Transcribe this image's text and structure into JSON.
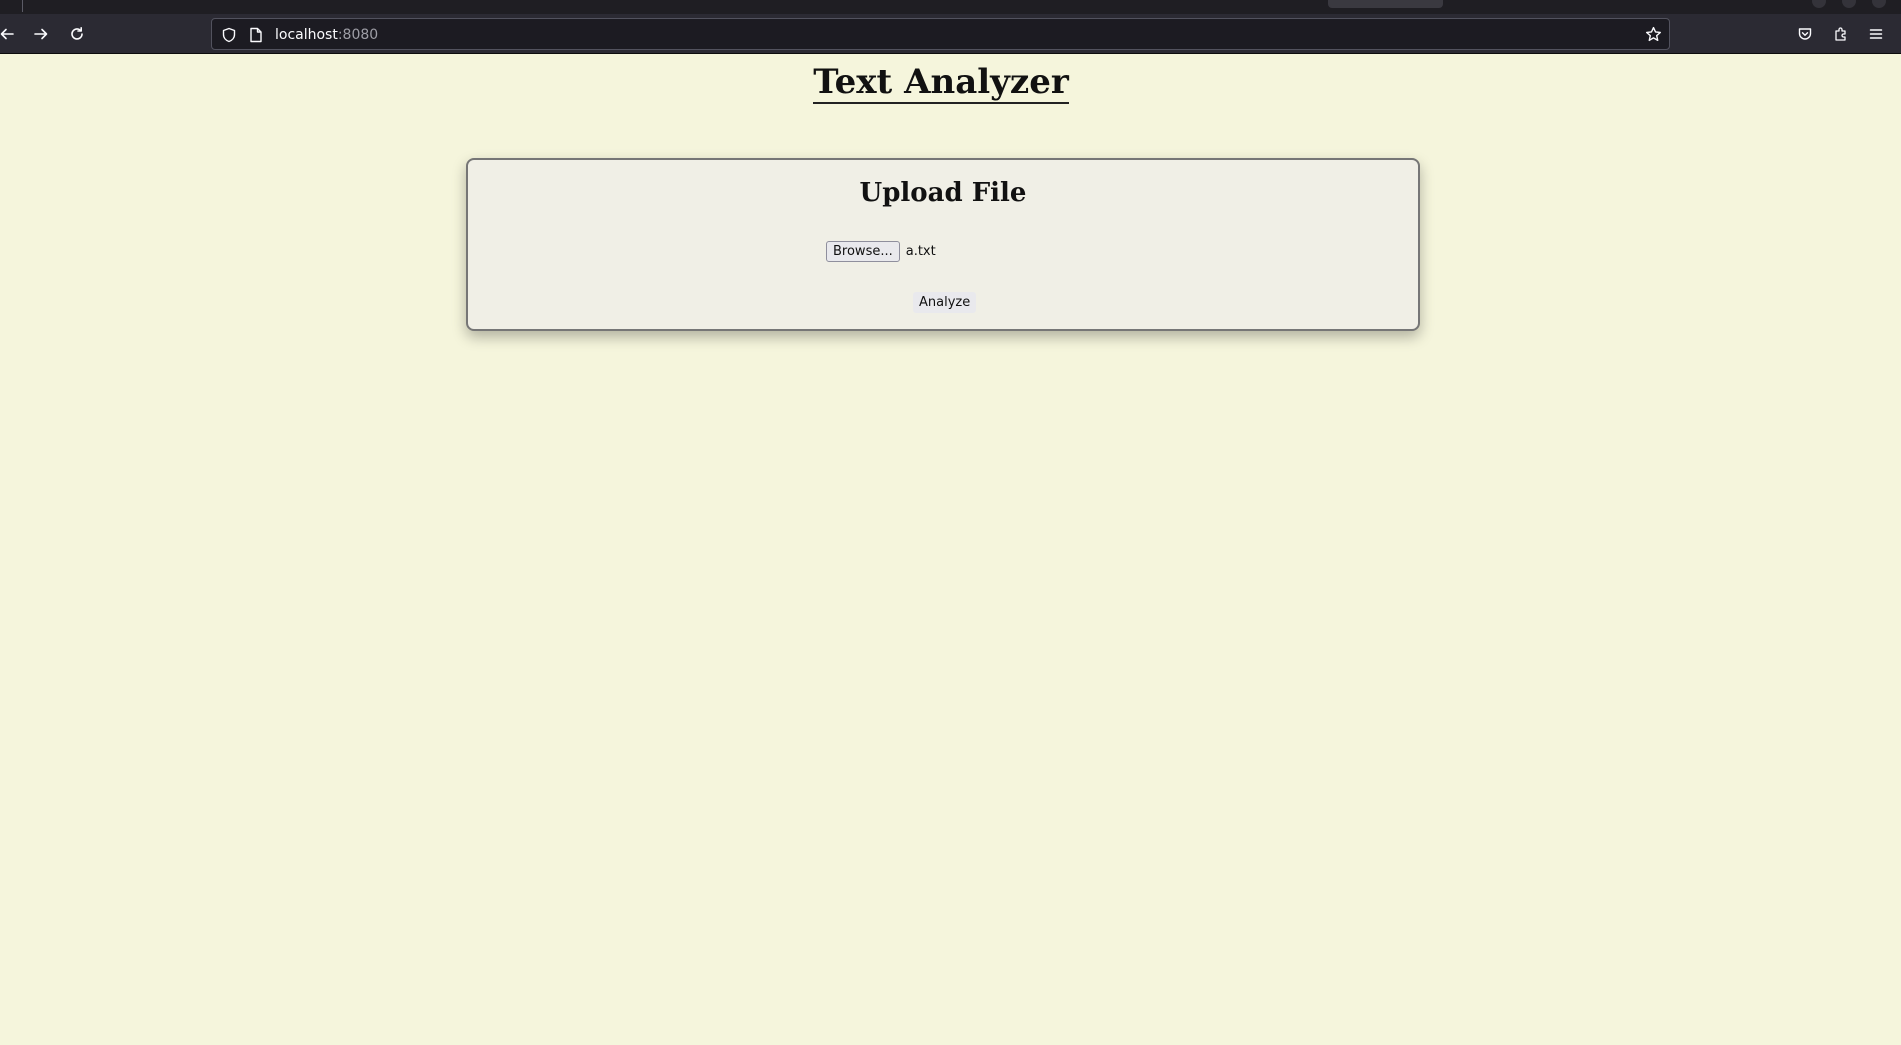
{
  "browser": {
    "url_host": "localhost",
    "url_port": ":8080"
  },
  "page": {
    "title": "Text Analyzer"
  },
  "upload": {
    "heading": "Upload File",
    "browse_label": "Browse...",
    "selected_file": "a.txt",
    "analyze_label": "Analyze"
  },
  "icons": {
    "back": "back-arrow-icon",
    "forward": "forward-arrow-icon",
    "reload": "reload-icon",
    "shield": "tracking-shield-icon",
    "page": "page-icon",
    "bookmark": "bookmark-star-icon",
    "pocket": "pocket-icon",
    "extensions": "extensions-icon",
    "menu": "hamburger-menu-icon"
  },
  "colors": {
    "page_background": "#f5f5dc",
    "card_background": "#f0efe6",
    "toolbar": "#2b2a33"
  }
}
